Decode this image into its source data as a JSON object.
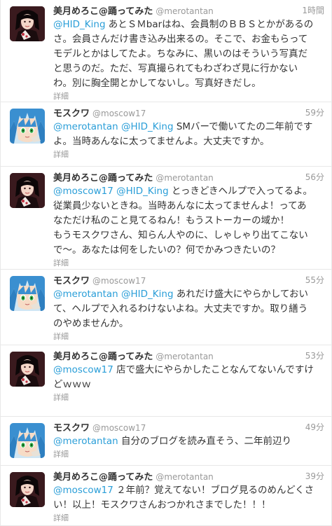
{
  "tweets": [
    {
      "avatar": "merotantan-avatar",
      "name": "美月めろこ@踊ってみた",
      "handle": "@merotantan",
      "time": "1時間",
      "lines": [
        [
          {
            "m": "@HID_King"
          },
          {
            "t": " あとＳＭbarはね、会員制のＢＢＳとかがあるの"
          }
        ],
        [
          {
            "t": "さ。会員さんだけ書き込み出来るの。そこで、お金もらって"
          }
        ],
        [
          {
            "t": "モデルとかはしてたよ。ちなみに、黒いのはそういう写真だ"
          }
        ],
        [
          {
            "t": "と思うのだ。ただ、写真撮られてもわざわざ見に行かない"
          }
        ],
        [
          {
            "t": "わ。別に胸全開とかしてないし。写真好きだし。"
          }
        ]
      ],
      "detail": "詳細"
    },
    {
      "avatar": "moscow17-avatar",
      "name": "モスクワ",
      "handle": "@moscow17",
      "time": "59分",
      "lines": [
        [
          {
            "m": "@merotantan"
          },
          {
            "t": " "
          },
          {
            "m": "@HID_King"
          },
          {
            "t": " SMバーで働いてたの二年前です"
          }
        ],
        [
          {
            "t": "よ。当時あんなに太ってませんよ。大丈夫ですか。"
          }
        ]
      ],
      "detail": "詳細"
    },
    {
      "avatar": "merotantan-avatar",
      "name": "美月めろこ@踊ってみた",
      "handle": "@merotantan",
      "time": "56分",
      "lines": [
        [
          {
            "m": "@moscow17"
          },
          {
            "t": " "
          },
          {
            "m": "@HID_King"
          },
          {
            "t": " とっきどきヘルプで入ってるよ。"
          }
        ],
        [
          {
            "t": "従業員少ないときね。当時あんなに太ってませんよ！ってあ"
          }
        ],
        [
          {
            "t": "なただけ私のこと見てるねん！もうストーカーの域か！"
          }
        ],
        [
          {
            "t": "もうモスクワさん、知らん人やのに、しゃしゃり出てこない"
          }
        ],
        [
          {
            "t": "で〜。あなたは何をしたいの？何でかみつきたいの？"
          }
        ]
      ],
      "detail": "詳細"
    },
    {
      "avatar": "moscow17-avatar",
      "name": "モスクワ",
      "handle": "@moscow17",
      "time": "55分",
      "lines": [
        [
          {
            "m": "@merotantan"
          },
          {
            "t": " "
          },
          {
            "m": "@HID_King"
          },
          {
            "t": " あれだけ盛大にやらかしておい"
          }
        ],
        [
          {
            "t": "て、ヘルプで入れるわけないよね。大丈夫ですか。取り繕う"
          }
        ],
        [
          {
            "t": "のやめませんか。"
          }
        ]
      ],
      "detail": "詳細"
    },
    {
      "avatar": "merotantan-avatar",
      "name": "美月めろこ@踊ってみた",
      "handle": "@merotantan",
      "time": "53分",
      "lines": [
        [
          {
            "m": "@moscow17"
          },
          {
            "t": " 店で盛大にやらかしたことなんてないんですけ"
          }
        ],
        [
          {
            "t": "どｗｗｗ"
          }
        ]
      ],
      "detail": "詳細"
    },
    {
      "avatar": "moscow17-avatar",
      "name": "モスクワ",
      "handle": "@moscow17",
      "time": "49分",
      "lines": [
        [
          {
            "m": "@merotantan"
          },
          {
            "t": " 自分のブログを読み直そう、二年前辺り"
          }
        ]
      ],
      "detail": "詳細"
    },
    {
      "avatar": "merotantan-avatar",
      "name": "美月めろこ@踊ってみた",
      "handle": "@merotantan",
      "time": "39分",
      "lines": [
        [
          {
            "m": "@moscow17"
          },
          {
            "t": " ２年前？覚えてない！ブログ見るのめんどくさ"
          }
        ],
        [
          {
            "t": "い！以上！モスクワさんおつかれさまでした！！！"
          }
        ]
      ],
      "detail": "詳細"
    }
  ],
  "colors": {
    "mention": "#2a9ed8",
    "meta": "#999999",
    "text": "#333333",
    "divider": "#e8e8e8"
  }
}
